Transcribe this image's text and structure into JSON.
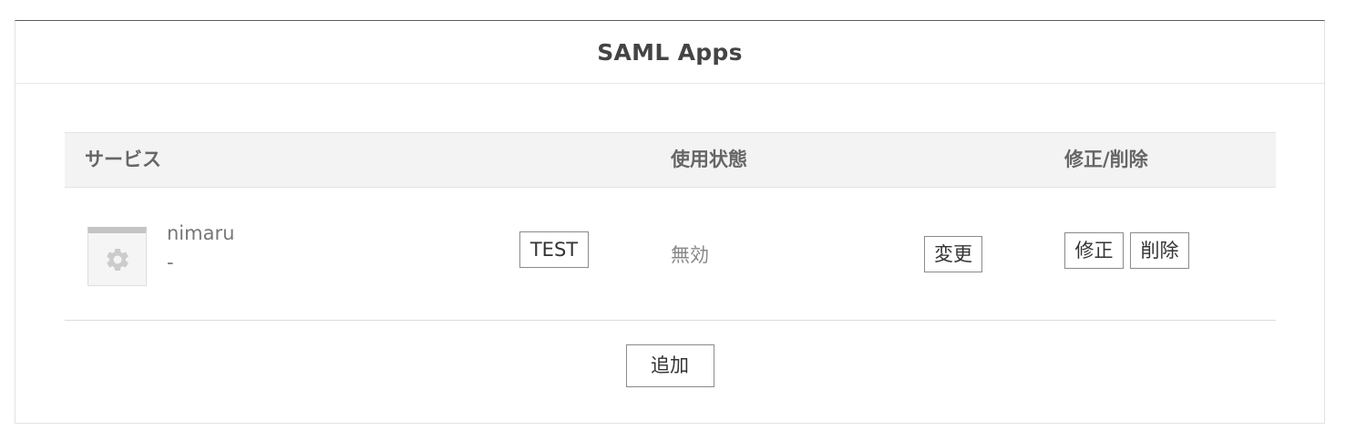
{
  "panel": {
    "title": "SAML Apps"
  },
  "table": {
    "headers": {
      "service": "サービス",
      "status": "使用状態",
      "edit_delete": "修正/削除"
    },
    "rows": [
      {
        "icon": "gear-icon",
        "name": "nimaru",
        "subtitle": "-",
        "test_label": "TEST",
        "status": "無効",
        "change_label": "変更",
        "edit_label": "修正",
        "delete_label": "削除"
      }
    ]
  },
  "actions": {
    "add_label": "追加"
  },
  "colors": {
    "header_bg": "#f3f3f3",
    "border": "#e2e2e2",
    "top_border": "#5a5a5a",
    "text": "#555555"
  }
}
